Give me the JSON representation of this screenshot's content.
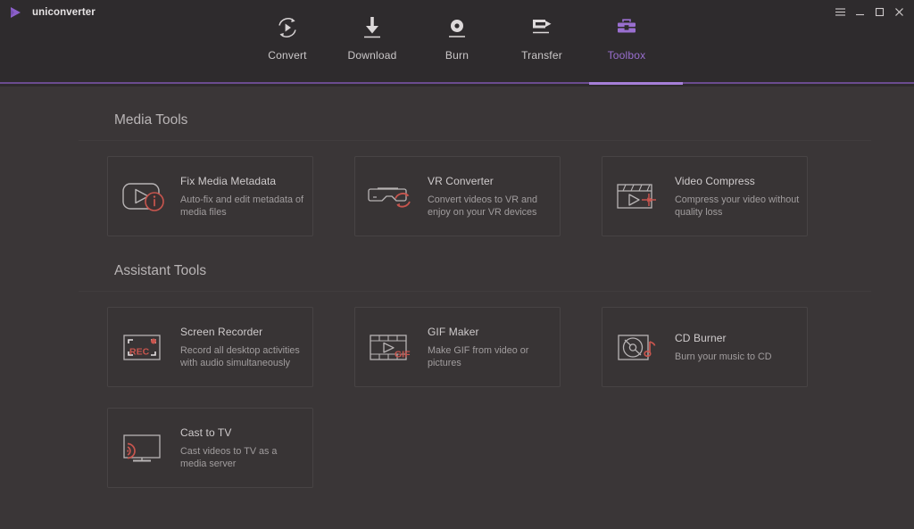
{
  "window": {
    "brand": "uniconverter",
    "brand_logo_icon": "play-triangle-logo",
    "controls": [
      {
        "name": "menu-button",
        "icon": "hamburger-icon",
        "label": "Menu"
      },
      {
        "name": "minimize-button",
        "icon": "minimize-icon",
        "label": "Minimize"
      },
      {
        "name": "maximize-button",
        "icon": "maximize-icon",
        "label": "Maximize"
      },
      {
        "name": "close-button",
        "icon": "close-icon",
        "label": "Close"
      }
    ]
  },
  "nav": {
    "active": "Toolbox",
    "items": [
      {
        "label": "Convert",
        "icon": "convert-circular-arrows-play-icon",
        "active": false
      },
      {
        "label": "Download",
        "icon": "download-arrow-icon",
        "active": false
      },
      {
        "label": "Burn",
        "icon": "burn-disc-icon",
        "active": false
      },
      {
        "label": "Transfer",
        "icon": "transfer-device-arrow-icon",
        "active": false
      },
      {
        "label": "Toolbox",
        "icon": "toolbox-case-icon",
        "active": true
      }
    ]
  },
  "colors": {
    "accent_purple": "#9a6fd0",
    "accent_purple_rule": "#6b4c8f",
    "accent_red": "#c8554e",
    "header_bg": "#2e2b2d",
    "content_bg": "#3a3637",
    "card_bg": "#383435",
    "card_border": "#474344",
    "icon_stroke": "#b8b4b5"
  },
  "sections": [
    {
      "title": "Media Tools",
      "cards": [
        {
          "title": "Fix Media Metadata",
          "desc": "Auto-fix and edit metadata of media files",
          "icon": "media-metadata-info-icon"
        },
        {
          "title": "VR Converter",
          "desc": "Convert videos to VR and enjoy on your VR devices",
          "icon": "vr-goggles-refresh-icon"
        },
        {
          "title": "Video Compress",
          "desc": "Compress your video without quality loss",
          "icon": "clapperboard-compress-icon"
        }
      ]
    },
    {
      "title": "Assistant Tools",
      "cards": [
        {
          "title": "Screen Recorder",
          "desc": "Record all desktop activities with audio simultaneously",
          "icon": "screen-record-frame-icon",
          "icon_label": "REC"
        },
        {
          "title": "GIF Maker",
          "desc": "Make GIF from video or pictures",
          "icon": "film-strip-gif-icon",
          "icon_label": "GIF"
        },
        {
          "title": "CD Burner",
          "desc": "Burn your music to CD",
          "icon": "cd-disc-music-note-icon"
        },
        {
          "title": "Cast to TV",
          "desc": "Cast videos to TV as a media server",
          "icon": "tv-cast-waves-icon"
        }
      ]
    }
  ]
}
